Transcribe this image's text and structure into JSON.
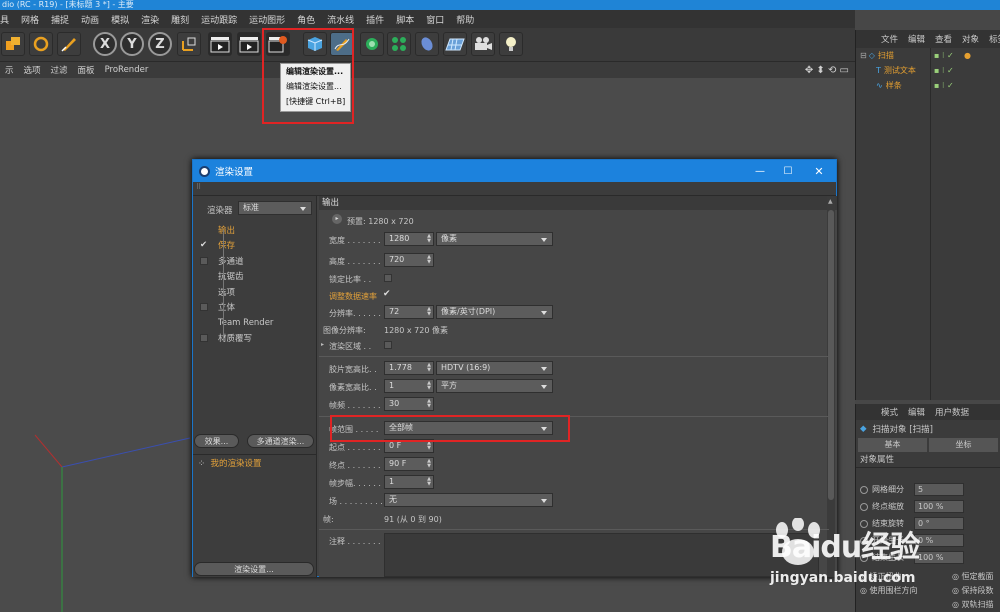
{
  "window_title": "dio (RC - R19) - [未标题 3 *] - 主要",
  "menu": [
    "具",
    "网格",
    "捕捉",
    "动画",
    "模拟",
    "渲染",
    "雕刻",
    "运动跟踪",
    "运动图形",
    "角色",
    "流水线",
    "插件",
    "脚本",
    "窗口",
    "帮助"
  ],
  "toolbar_letters": {
    "x": "X",
    "y": "Y",
    "z": "Z"
  },
  "viewport_menu": [
    "示",
    "选项",
    "过滤",
    "面板",
    "ProRender"
  ],
  "dropdown_menu": [
    "编辑渲染设置...",
    "编辑渲染设置...",
    "[快捷键 Ctrl+B]"
  ],
  "object_manager": {
    "tabs": [
      "文件",
      "编辑",
      "查看",
      "对象",
      "标签"
    ],
    "objects": [
      {
        "name": "扫描",
        "color": "#e6a030"
      },
      {
        "name": "测试文本",
        "color": "#e6a030"
      },
      {
        "name": "样条",
        "color": "#e6a030"
      }
    ]
  },
  "attribute_manager": {
    "tabs": [
      "模式",
      "编辑",
      "用户数据"
    ],
    "object_label": "扫描对象 [扫描]",
    "sub_tabs": [
      "基本",
      "坐标"
    ],
    "section": "对象属性",
    "rows": [
      {
        "label": "网格细分",
        "value": "5"
      },
      {
        "label": "终点缩放",
        "value": "100 %"
      },
      {
        "label": "结束旋转",
        "value": "0 °"
      },
      {
        "label": "开始生长",
        "value": "0 %"
      },
      {
        "label": "结束生长",
        "value": "100 %"
      }
    ],
    "bottom_labels": [
      "矫正扭曲",
      "使用围栏方向",
      "恒定截面",
      "保持段数",
      "双轨扫描"
    ]
  },
  "dialog": {
    "title": "渲染设置",
    "renderer_label": "渲染器",
    "renderer_value": "标准",
    "nav": [
      {
        "label": "输出",
        "check": "none",
        "active": true
      },
      {
        "label": "保存",
        "check": "tick",
        "active": true
      },
      {
        "label": "多通道",
        "check": "box",
        "active": false
      },
      {
        "label": "抗锯齿",
        "check": "none",
        "active": false
      },
      {
        "label": "选项",
        "check": "none",
        "active": false
      },
      {
        "label": "立体",
        "check": "box",
        "active": false
      },
      {
        "label": "Team Render",
        "check": "none",
        "active": false
      },
      {
        "label": "材质覆写",
        "check": "box",
        "active": false
      }
    ],
    "effects_button": "效果...",
    "multipass_button": "多通道渲染...",
    "my_settings": "我的渲染设置",
    "render_settings_button": "渲染设置...",
    "section_title": "输出",
    "preset_label": "预置: 1280 x 720",
    "width": {
      "label": "宽度 . . . . . . .",
      "value": "1280",
      "unit": "像素"
    },
    "height": {
      "label": "高度 . . . . . . .",
      "value": "720"
    },
    "lock_ratio": "锁定比率 . .",
    "adjust_rate": "调整数据速率",
    "resolution": {
      "label": "分辨率. . . . . .",
      "value": "72",
      "unit": "像素/英寸(DPI)"
    },
    "image_resolution": {
      "label": "图像分辨率:",
      "value": "1280 x 720 像素"
    },
    "render_region": "渲染区域 . .",
    "film_aspect": {
      "label": "胶片宽高比. .",
      "value": "1.778",
      "preset": "HDTV (16:9)"
    },
    "pixel_aspect": {
      "label": "像素宽高比. .",
      "value": "1",
      "preset": "平方"
    },
    "fps": {
      "label": "帧频 . . . . . . .",
      "value": "30"
    },
    "frame_range": {
      "label": "帧范围 . . . . .",
      "value": "全部帧"
    },
    "start": {
      "label": "起点 . . . . . . .",
      "value": "0 F"
    },
    "end": {
      "label": "终点 . . . . . . .",
      "value": "90 F"
    },
    "step": {
      "label": "帧步幅. . . . . .",
      "value": "1"
    },
    "field": {
      "label": "场 . . . . . . . . .",
      "value": "无"
    },
    "frames": {
      "label": "帧:",
      "value": "91 (从 0 到 90)"
    },
    "notes": "注释 . . . . . . ."
  },
  "watermark": {
    "brand": "Baidu经验",
    "url": "jingyan.baidu.com"
  }
}
